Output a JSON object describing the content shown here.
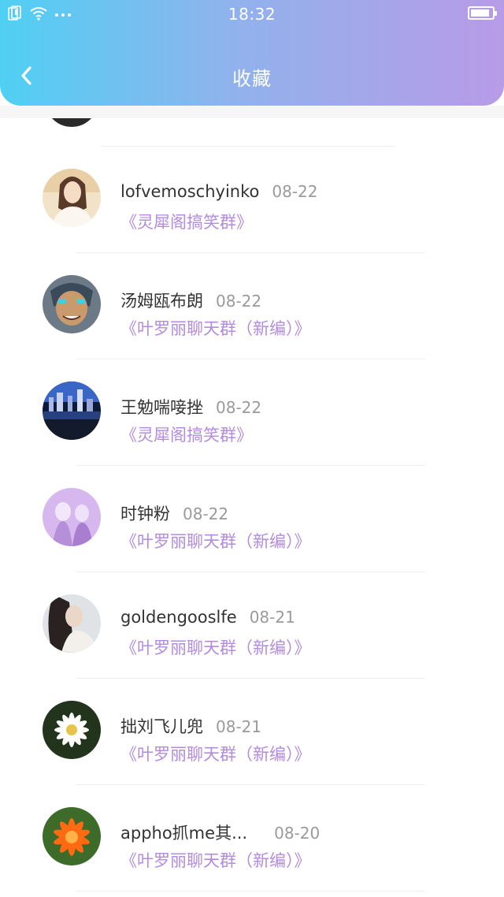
{
  "status_bar": {
    "time": "18:32"
  },
  "header": {
    "title": "收藏"
  },
  "items": [
    {
      "name": "lofvemoschyinko",
      "date": "08-22",
      "group": "《灵犀阁搞笑群》"
    },
    {
      "name": "汤姆瓯布朗",
      "date": "08-22",
      "group": "《叶罗丽聊天群（新编）》"
    },
    {
      "name": "王勉喘唼挫",
      "date": "08-22",
      "group": "《灵犀阁搞笑群》"
    },
    {
      "name": "时钟粉",
      "date": "08-22",
      "group": "《叶罗丽聊天群（新编）》"
    },
    {
      "name": "goldengooslfe",
      "date": "08-21",
      "group": "《叶罗丽聊天群（新编）》"
    },
    {
      "name": "拙刘飞儿兜",
      "date": "08-21",
      "group": "《叶罗丽聊天群（新编）》"
    },
    {
      "name": "appho抓me其...",
      "date": "08-20",
      "group": "《叶罗丽聊天群（新编）》"
    }
  ],
  "colors": {
    "accent_purple": "#b38be0",
    "header_start": "#4fd0f3",
    "header_end": "#b89be8"
  }
}
